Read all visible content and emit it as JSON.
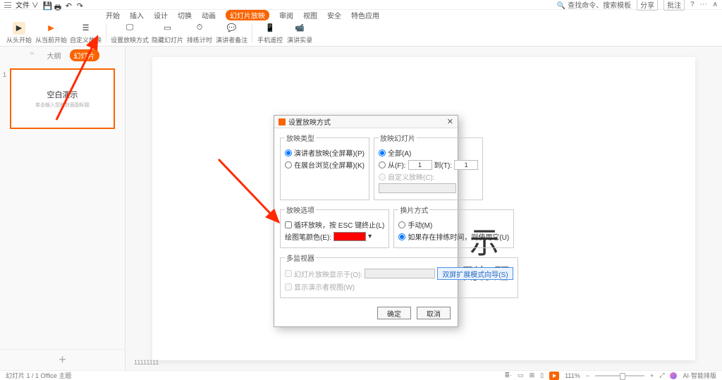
{
  "topbar": {
    "file_label": "文件 ∨",
    "search_placeholder": "查找命令、搜索模板",
    "share": "分享",
    "notes": "批注"
  },
  "menu": {
    "items": [
      "开始",
      "插入",
      "设计",
      "切换",
      "动画",
      "幻灯片放映",
      "审阅",
      "视图",
      "安全",
      "特色应用"
    ],
    "active_idx": 5
  },
  "ribbon": {
    "items": [
      "从头开始",
      "从当前开始",
      "自定义放映",
      "设置放映方式",
      "隐藏幻灯片",
      "排练计时",
      "演讲者备注",
      "手机遥控",
      "演讲实录"
    ]
  },
  "sidebar": {
    "tab1": "大纲",
    "tab2": "幻灯片",
    "thumb_num": "1",
    "thumb_title": "空白演示",
    "thumb_sub": "单击输入您的封面副标题"
  },
  "slide": {
    "big": "示",
    "sub": "副标题",
    "corner": "11111111"
  },
  "status": {
    "left": "幻灯片 1 / 1    Office 主题",
    "zoom": "111%",
    "ai": "AI·智能排版"
  },
  "dialog": {
    "title": "设置放映方式",
    "g_type": "放映类型",
    "type_opt1": "演讲者放映(全屏幕)(P)",
    "type_opt2": "在展台浏览(全屏幕)(K)",
    "g_slides": "放映幻灯片",
    "slides_all": "全部(A)",
    "slides_from": "从(F):",
    "slides_to": "到(T):",
    "slides_from_val": "1",
    "slides_to_val": "1",
    "slides_custom": "自定义放映(C):",
    "g_options": "放映选项",
    "opt_loop": "循环放映，按 ESC 键终止(L)",
    "opt_pen": "绘图笔颜色(E):",
    "g_advance": "换片方式",
    "adv_manual": "手动(M)",
    "adv_timing": "如果存在排练时间，则使用它(U)",
    "g_monitors": "多监视器",
    "mon_on": "幻灯片放映显示于(O):",
    "mon_wizard": "双屏扩展模式向导(S)",
    "mon_presenter": "显示演示者视图(W)",
    "ok": "确定",
    "cancel": "取消"
  }
}
